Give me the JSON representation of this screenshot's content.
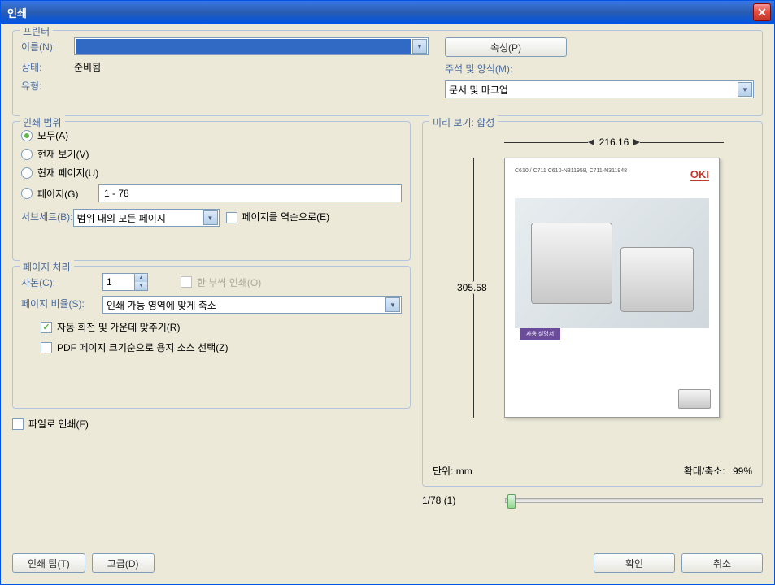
{
  "title": "인쇄",
  "printer": {
    "legend": "프린터",
    "name_label": "이름(N):",
    "name_value": "",
    "properties_btn": "속성(P)",
    "status_label": "상태:",
    "status_value": "준비됨",
    "type_label": "유형:",
    "comments_label": "주석 및 양식(M):",
    "comments_value": "문서 및 마크업"
  },
  "range": {
    "legend": "인쇄 범위",
    "all": "모두(A)",
    "current_view": "현재 보기(V)",
    "current_page": "현재 페이지(U)",
    "pages": "페이지(G)",
    "pages_value": "1 - 78",
    "subset_label": "서브세트(B):",
    "subset_value": "범위 내의 모든 페이지",
    "reverse": "페이지를 역순으로(E)"
  },
  "handling": {
    "legend": "페이지 처리",
    "copies_label": "사본(C):",
    "copies_value": "1",
    "collate": "한 부씩 인쇄(O)",
    "scaling_label": "페이지 비율(S):",
    "scaling_value": "인쇄 가능 영역에 맞게 축소",
    "auto_rotate": "자동 회전 및 가운데 맞추기(R)",
    "paper_source": "PDF 페이지 크기순으로 용지 소스 선택(Z)"
  },
  "print_to_file": "파일로 인쇄(F)",
  "preview": {
    "legend": "미리 보기: 합성",
    "width": "216.16",
    "height": "305.58",
    "units_label": "단위:",
    "units_value": "mm",
    "zoom_label": "확대/축소:",
    "zoom_value": "99%",
    "page_indicator": "1/78 (1)",
    "doc_header": "C610 / C711  C610-N311958, C711-N311948",
    "doc_logo": "OKI",
    "doc_tag": "사용 설명서"
  },
  "buttons": {
    "tips": "인쇄 팁(T)",
    "advanced": "고급(D)",
    "ok": "확인",
    "cancel": "취소"
  }
}
